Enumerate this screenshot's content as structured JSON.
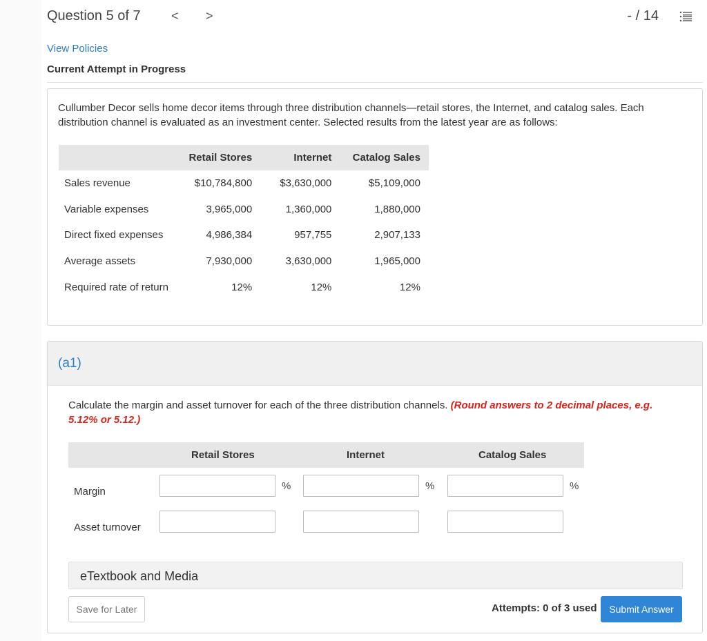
{
  "header": {
    "question_title": "Question 5 of 7",
    "prev_glyph": "<",
    "next_glyph": ">",
    "score": "- / 14"
  },
  "view_policies": "View Policies",
  "attempt_heading": "Current Attempt in Progress",
  "problem": {
    "text": "Cullumber Decor sells home decor items through three distribution channels—retail stores, the Internet, and catalog sales. Each distribution channel is evaluated as an investment center. Selected results from the latest year are as follows:",
    "columns": [
      "Retail Stores",
      "Internet",
      "Catalog Sales"
    ],
    "rows": [
      {
        "label": "Sales revenue",
        "values": [
          "$10,784,800",
          "$3,630,000",
          "$5,109,000"
        ]
      },
      {
        "label": "Variable expenses",
        "values": [
          "3,965,000",
          "1,360,000",
          "1,880,000"
        ]
      },
      {
        "label": "Direct fixed expenses",
        "values": [
          "4,986,384",
          "957,755",
          "2,907,133"
        ]
      },
      {
        "label": "Average assets",
        "values": [
          "7,930,000",
          "3,630,000",
          "1,965,000"
        ]
      },
      {
        "label": "Required rate of return",
        "values": [
          "12%",
          "12%",
          "12%"
        ]
      }
    ]
  },
  "part": {
    "label": "(a1)",
    "instruction": "Calculate the margin and asset turnover for each of the three distribution channels. ",
    "instruction_red": "(Round answers to 2 decimal places, e.g. 5.12% or 5.12.)",
    "columns": [
      "Retail Stores",
      "Internet",
      "Catalog Sales"
    ],
    "rows": [
      {
        "label": "Margin",
        "unit": "%",
        "values": [
          "",
          "",
          ""
        ]
      },
      {
        "label": "Asset turnover",
        "unit": "",
        "values": [
          "",
          "",
          ""
        ]
      }
    ]
  },
  "etextbook": "eTextbook and Media",
  "footer": {
    "save_label": "Save for Later",
    "attempts_text": "Attempts: 0 of 3 used",
    "submit_label": "Submit Answer"
  },
  "colors": {
    "link": "#2a7ec8",
    "warning": "#d8231b",
    "submit": "#2f86d7"
  }
}
